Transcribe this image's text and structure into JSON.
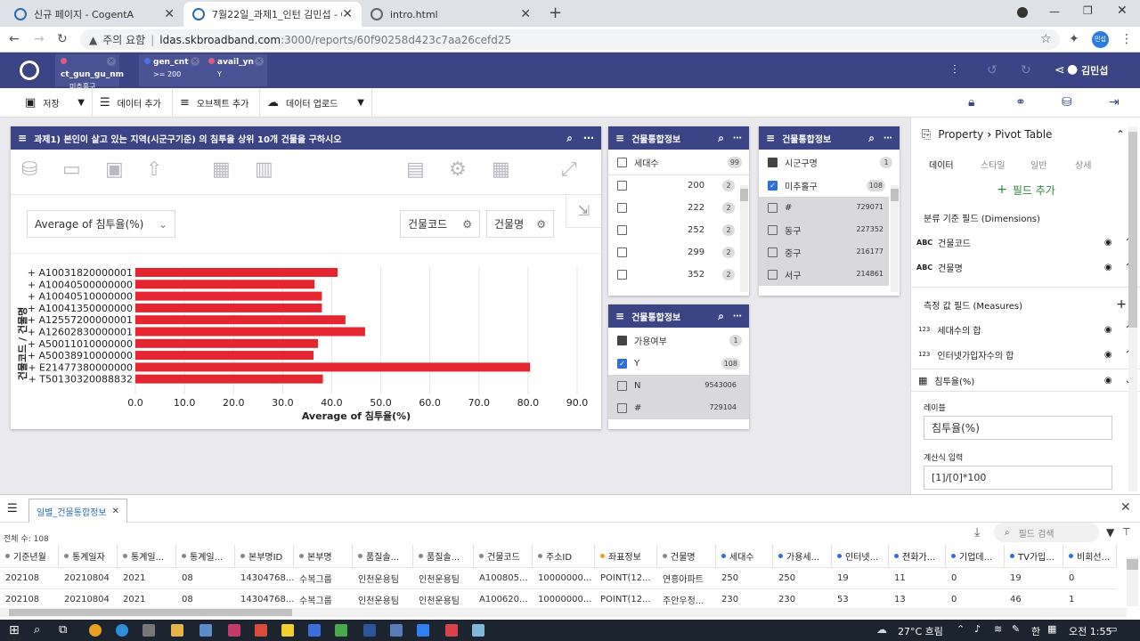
{
  "browser": {
    "tabs": [
      {
        "title": "신규 페이지 - CogentA"
      },
      {
        "title": "7월22일_과제1_인턴 김민섭 - Co"
      },
      {
        "title": "intro.html"
      }
    ],
    "security": "주의 요함",
    "url_host": "ldas.skbroadband.com",
    "url_path": ":3000/reports/60f90258d423c7aa26cefd25",
    "profile": "민섭"
  },
  "header": {
    "filters": [
      {
        "name": "ct_gun_gu_nm",
        "value": "미추홀구",
        "color": "#e05a8a"
      },
      {
        "name": "gen_cnt",
        "value": ">= 200",
        "color": "#4a72e8"
      },
      {
        "name": "avail_yn",
        "value": "Y",
        "color": "#e05a8a"
      }
    ],
    "user": "김민섭"
  },
  "toolbar": {
    "save": "저장",
    "add_data": "데이터 추가",
    "add_object": "오브젝트 추가",
    "upload": "데이터 업로드"
  },
  "chart_panel": {
    "title": "과제1) 본인이 살고 있는 지역(시군구기준) 의 침투율 상위 10개 건물을 구하시오",
    "measure_select": "Average of 침투율(%)",
    "dim_buttons": [
      "건물코드",
      "건물명"
    ]
  },
  "chart_data": {
    "type": "bar",
    "orientation": "horizontal",
    "categories": [
      "+ A10031820000001",
      "+ A10040500000000",
      "+ A10040510000000",
      "+ A10041350000000",
      "+ A12557200000001",
      "+ A12602830000001",
      "+ A50011010000000",
      "+ A50038910000000",
      "+ E21477380000000",
      "+ T50130320088832"
    ],
    "values": [
      41.2,
      36.5,
      38.0,
      38.0,
      42.8,
      46.8,
      37.2,
      36.3,
      80.4,
      38.2
    ],
    "xlabel": "Average of 침투율(%)",
    "ylabel": "건물코드 / 건물명",
    "xlim": [
      0,
      90
    ],
    "xticks": [
      "0.0",
      "10.0",
      "20.0",
      "30.0",
      "40.0",
      "50.0",
      "60.0",
      "70.0",
      "80.0",
      "90.0"
    ],
    "bar_color": "#e52530",
    "grid": true
  },
  "list_a": {
    "title": "건물통합정보",
    "field": "세대수",
    "count": "99",
    "items": [
      {
        "label": "200",
        "count": "2"
      },
      {
        "label": "222",
        "count": "2"
      },
      {
        "label": "252",
        "count": "2"
      },
      {
        "label": "299",
        "count": "2"
      },
      {
        "label": "352",
        "count": "2"
      }
    ]
  },
  "list_b": {
    "title": "건물통합정보",
    "field": "시군구명",
    "count": "1",
    "items": [
      {
        "label": "미추홀구",
        "count": "108",
        "checked": true
      },
      {
        "label": "#",
        "count": "729071"
      },
      {
        "label": "동구",
        "count": "227352"
      },
      {
        "label": "중구",
        "count": "216177"
      },
      {
        "label": "서구",
        "count": "214861"
      }
    ]
  },
  "list_c": {
    "title": "건물통합정보",
    "field": "가용여부",
    "count": "1",
    "items": [
      {
        "label": "Y",
        "count": "108",
        "checked": true
      },
      {
        "label": "N",
        "count": "9543006"
      },
      {
        "label": "#",
        "count": "729104"
      }
    ]
  },
  "property": {
    "breadcrumb_a": "Property",
    "breadcrumb_b": "Pivot Table",
    "tabs": [
      "데이터",
      "스타일",
      "일반",
      "상세"
    ],
    "add_field": "필드 추가",
    "dims_title": "분류 기준 필드 (Dimensions)",
    "dims": [
      {
        "type": "ABC",
        "name": "건물코드"
      },
      {
        "type": "ABC",
        "name": "건물명"
      }
    ],
    "measures_title": "측정 값 필드 (Measures)",
    "measures": [
      {
        "type": "123",
        "name": "세대수의 합"
      },
      {
        "type": "123",
        "name": "인터넷가입자수의 합"
      },
      {
        "type": "calc",
        "name": "침투율(%)"
      }
    ],
    "label_title": "레이블",
    "label_value": "침투율(%)",
    "formula_title": "계산식 입력",
    "formula_value": "[1]/[0]*100"
  },
  "grid": {
    "tab": "일별_건물통합정보",
    "total": "전체 수: 108",
    "search_placeholder": "필드 검색",
    "columns": [
      "기준년월",
      "통계일자",
      "통계일...",
      "통계일...",
      "본부명ID",
      "본부명",
      "품질솔...",
      "품질솔...",
      "건물코드",
      "주소ID",
      "좌표정보",
      "건물명",
      "세대수",
      "가용세...",
      "인터넷...",
      "전화가...",
      "기업데...",
      "TV가입...",
      "비회선..."
    ],
    "rows": [
      [
        "202108",
        "20210804",
        "2021",
        "08",
        "14304768...",
        "수복그룹",
        "인천운용팀",
        "인천운용팀",
        "A100805...",
        "10000000...",
        "POINT(12...",
        "연흥아파트",
        "250",
        "250",
        "19",
        "11",
        "0",
        "19",
        "0"
      ],
      [
        "202108",
        "20210804",
        "2021",
        "08",
        "14304768...",
        "수복그룹",
        "인천운용팀",
        "인천운용팀",
        "A100620...",
        "10000000...",
        "POINT(12...",
        "주안우정...",
        "230",
        "230",
        "53",
        "13",
        "0",
        "46",
        "1"
      ]
    ]
  },
  "taskbar": {
    "weather": "27°C 흐림",
    "ime": "한",
    "time": "오전 1:55"
  }
}
